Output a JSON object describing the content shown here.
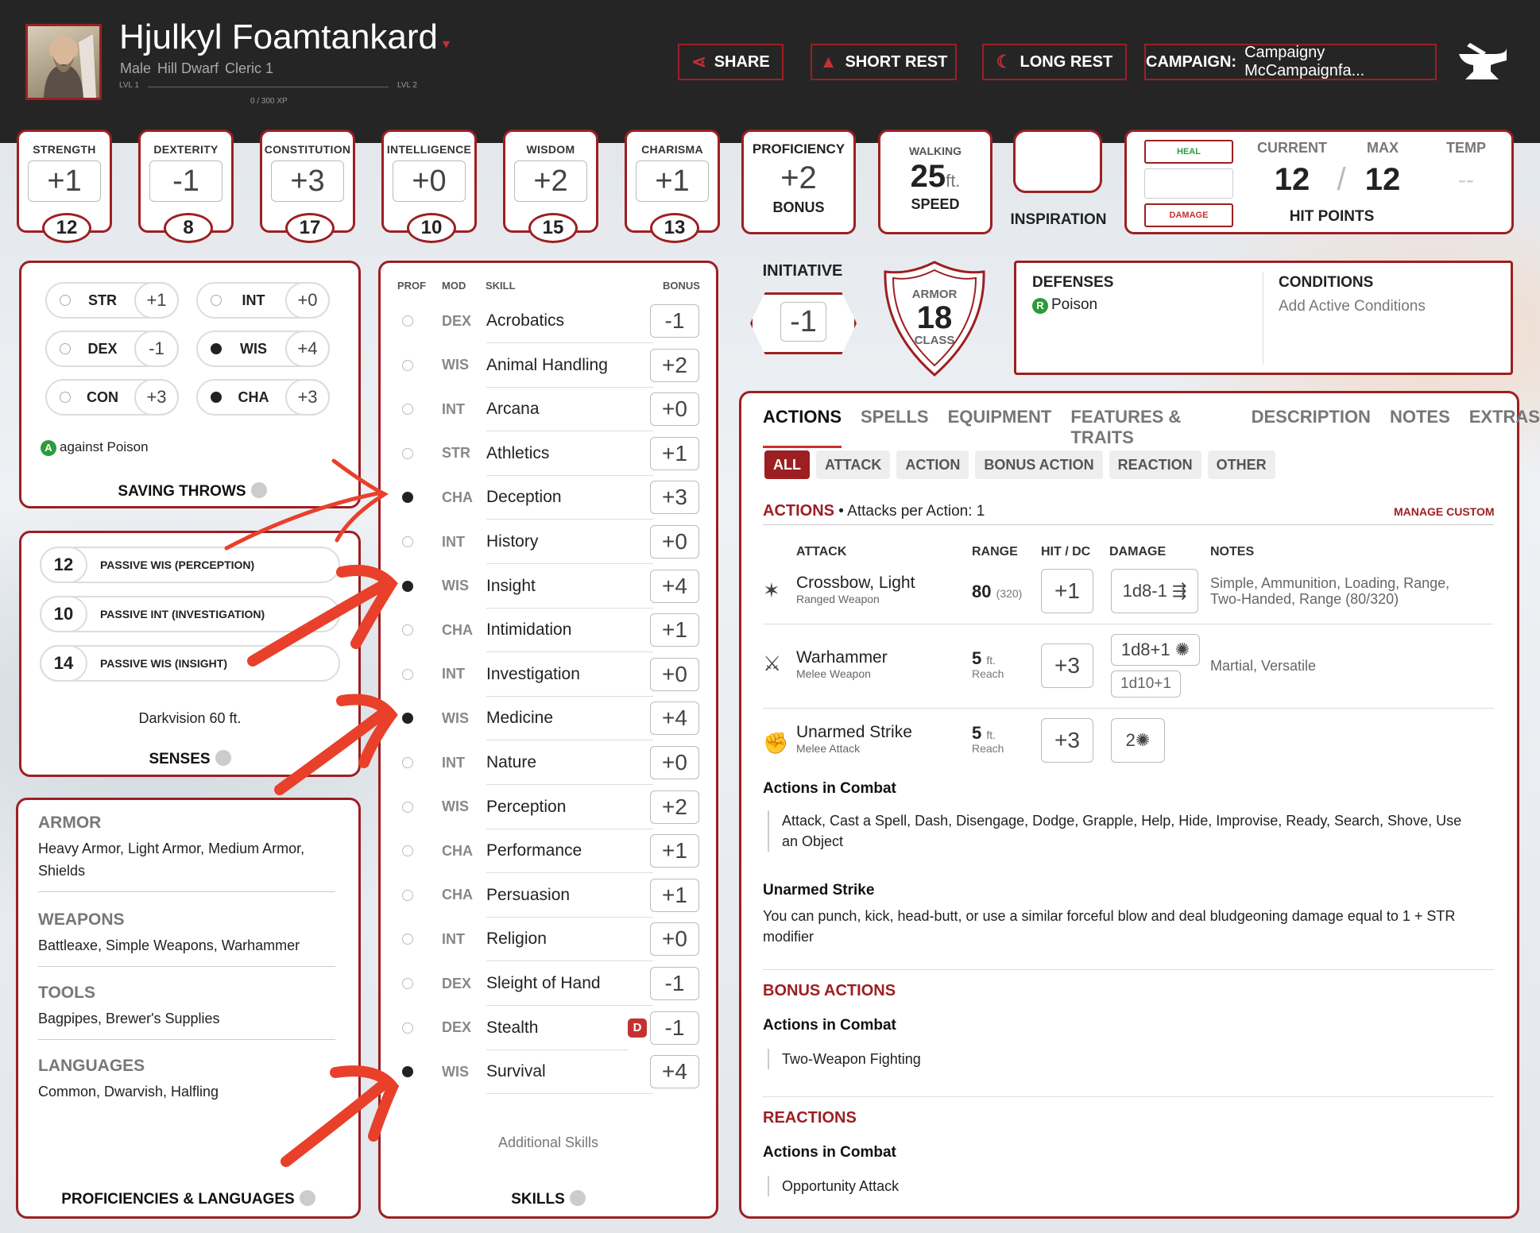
{
  "header": {
    "name": "Hjulkyl Foamtankard",
    "gender": "Male",
    "race": "Hill Dwarf",
    "class": "Cleric 1",
    "lvl_left": "LVL 1",
    "lvl_right": "LVL 2",
    "xp": "0 / 300 XP",
    "share": "SHARE",
    "short_rest": "SHORT REST",
    "long_rest": "LONG REST",
    "campaign_label": "CAMPAIGN:",
    "campaign_value": "Campaigny McCampaignfa..."
  },
  "abilities": [
    {
      "name": "STRENGTH",
      "mod": "+1",
      "score": "12"
    },
    {
      "name": "DEXTERITY",
      "mod": "-1",
      "score": "8"
    },
    {
      "name": "CONSTITUTION",
      "mod": "+3",
      "score": "17"
    },
    {
      "name": "INTELLIGENCE",
      "mod": "+0",
      "score": "10"
    },
    {
      "name": "WISDOM",
      "mod": "+2",
      "score": "15"
    },
    {
      "name": "CHARISMA",
      "mod": "+1",
      "score": "13"
    }
  ],
  "proficiency": {
    "label": "PROFICIENCY",
    "value": "+2",
    "sub": "BONUS"
  },
  "speed": {
    "label": "WALKING",
    "value": "25",
    "unit": "ft.",
    "sub": "SPEED"
  },
  "inspiration": {
    "label": "INSPIRATION"
  },
  "hp": {
    "heal": "HEAL",
    "damage": "DAMAGE",
    "current_label": "CURRENT",
    "max_label": "MAX",
    "temp_label": "TEMP",
    "current": "12",
    "slash": "/",
    "max": "12",
    "temp": "--",
    "title": "HIT POINTS"
  },
  "saves": {
    "items": [
      {
        "name": "STR",
        "value": "+1",
        "prof": false
      },
      {
        "name": "INT",
        "value": "+0",
        "prof": false
      },
      {
        "name": "DEX",
        "value": "-1",
        "prof": false
      },
      {
        "name": "WIS",
        "value": "+4",
        "prof": true
      },
      {
        "name": "CON",
        "value": "+3",
        "prof": false
      },
      {
        "name": "CHA",
        "value": "+3",
        "prof": true
      }
    ],
    "note_badge": "A",
    "note": "against Poison",
    "title": "SAVING THROWS"
  },
  "senses": {
    "items": [
      {
        "value": "12",
        "label": "PASSIVE WIS (PERCEPTION)"
      },
      {
        "value": "10",
        "label": "PASSIVE INT (INVESTIGATION)"
      },
      {
        "value": "14",
        "label": "PASSIVE WIS (INSIGHT)"
      }
    ],
    "darkvision": "Darkvision 60 ft.",
    "title": "SENSES"
  },
  "proficiencies": {
    "groups": [
      {
        "h": "ARMOR",
        "t": "Heavy Armor, Light Armor, Medium Armor, Shields"
      },
      {
        "h": "WEAPONS",
        "t": "Battleaxe, Simple Weapons, Warhammer"
      },
      {
        "h": "TOOLS",
        "t": "Bagpipes, Brewer's Supplies"
      },
      {
        "h": "LANGUAGES",
        "t": "Common, Dwarvish, Halfling"
      }
    ],
    "title": "PROFICIENCIES & LANGUAGES"
  },
  "skills": {
    "headers": {
      "prof": "PROF",
      "mod": "MOD",
      "skill": "SKILL",
      "bonus": "BONUS"
    },
    "items": [
      {
        "mod": "DEX",
        "name": "Acrobatics",
        "bonus": "-1",
        "prof": false
      },
      {
        "mod": "WIS",
        "name": "Animal Handling",
        "bonus": "+2",
        "prof": false
      },
      {
        "mod": "INT",
        "name": "Arcana",
        "bonus": "+0",
        "prof": false
      },
      {
        "mod": "STR",
        "name": "Athletics",
        "bonus": "+1",
        "prof": false
      },
      {
        "mod": "CHA",
        "name": "Deception",
        "bonus": "+3",
        "prof": true
      },
      {
        "mod": "INT",
        "name": "History",
        "bonus": "+0",
        "prof": false
      },
      {
        "mod": "WIS",
        "name": "Insight",
        "bonus": "+4",
        "prof": true
      },
      {
        "mod": "CHA",
        "name": "Intimidation",
        "bonus": "+1",
        "prof": false
      },
      {
        "mod": "INT",
        "name": "Investigation",
        "bonus": "+0",
        "prof": false
      },
      {
        "mod": "WIS",
        "name": "Medicine",
        "bonus": "+4",
        "prof": true
      },
      {
        "mod": "INT",
        "name": "Nature",
        "bonus": "+0",
        "prof": false
      },
      {
        "mod": "WIS",
        "name": "Perception",
        "bonus": "+2",
        "prof": false
      },
      {
        "mod": "CHA",
        "name": "Performance",
        "bonus": "+1",
        "prof": false
      },
      {
        "mod": "CHA",
        "name": "Persuasion",
        "bonus": "+1",
        "prof": false
      },
      {
        "mod": "INT",
        "name": "Religion",
        "bonus": "+0",
        "prof": false
      },
      {
        "mod": "DEX",
        "name": "Sleight of Hand",
        "bonus": "-1",
        "prof": false
      },
      {
        "mod": "DEX",
        "name": "Stealth",
        "bonus": "-1",
        "prof": false,
        "disadv": "D"
      },
      {
        "mod": "WIS",
        "name": "Survival",
        "bonus": "+4",
        "prof": true
      }
    ],
    "additional": "Additional Skills",
    "title": "SKILLS"
  },
  "initiative": {
    "label": "INITIATIVE",
    "value": "-1"
  },
  "armor": {
    "top": "ARMOR",
    "value": "18",
    "bottom": "CLASS"
  },
  "defenses": {
    "title": "DEFENSES",
    "badge": "R",
    "item": "Poison"
  },
  "conditions": {
    "title": "CONDITIONS",
    "add": "Add Active Conditions"
  },
  "tabs": [
    "ACTIONS",
    "SPELLS",
    "EQUIPMENT",
    "FEATURES & TRAITS",
    "DESCRIPTION",
    "NOTES",
    "EXTRAS"
  ],
  "subtabs": [
    "ALL",
    "ATTACK",
    "ACTION",
    "BONUS ACTION",
    "REACTION",
    "OTHER"
  ],
  "actions": {
    "title": "ACTIONS",
    "per_action": "• Attacks per Action: 1",
    "manage": "MANAGE CUSTOM",
    "cols": {
      "attack": "ATTACK",
      "range": "RANGE",
      "hit": "HIT / DC",
      "damage": "DAMAGE",
      "notes": "NOTES"
    },
    "attacks": [
      {
        "name": "Crossbow, Light",
        "type": "Ranged Weapon",
        "range": "80",
        "range_long": "(320)",
        "range_sub": "",
        "hit": "+1",
        "damage": "1d8-1",
        "damage2": "",
        "notes": "Simple, Ammunition, Loading, Range, Two-Handed, Range (80/320)"
      },
      {
        "name": "Warhammer",
        "type": "Melee Weapon",
        "range": "5",
        "range_long": "ft.",
        "range_sub": "Reach",
        "hit": "+3",
        "damage": "1d8+1",
        "damage2": "1d10+1",
        "notes": "Martial, Versatile"
      },
      {
        "name": "Unarmed Strike",
        "type": "Melee Attack",
        "range": "5",
        "range_long": "ft.",
        "range_sub": "Reach",
        "hit": "+3",
        "damage": "2",
        "damage2": "",
        "notes": ""
      }
    ],
    "combat_h": "Actions in Combat",
    "combat": "Attack, Cast a Spell, Dash, Disengage, Dodge, Grapple, Help, Hide, Improvise, Ready, Search, Shove, Use an Object",
    "unarmed_h": "Unarmed Strike",
    "unarmed": "You can punch, kick, head-butt, or use a similar forceful blow and deal bludgeoning damage equal to 1 + STR modifier",
    "bonus_h": "BONUS ACTIONS",
    "bonus_combat_h": "Actions in Combat",
    "bonus_combat": "Two-Weapon Fighting",
    "reactions_h": "REACTIONS",
    "react_combat_h": "Actions in Combat",
    "react_combat": "Opportunity Attack"
  },
  "colors": {
    "accent": "#9d1f22",
    "header": "#252525",
    "annotation": "#e8402a"
  }
}
